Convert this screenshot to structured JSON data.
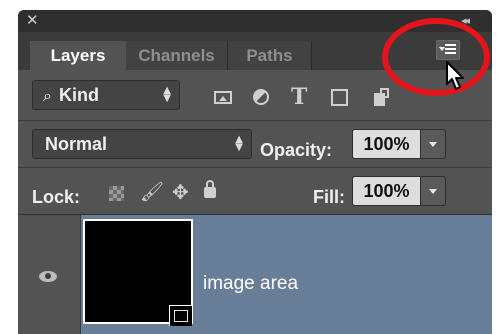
{
  "window": {
    "close_glyph": "✕",
    "collapse_glyph": "◂◂"
  },
  "tabs": [
    {
      "label": "Layers",
      "active": true
    },
    {
      "label": "Channels",
      "active": false
    },
    {
      "label": "Paths",
      "active": false
    }
  ],
  "panel_menu": {
    "icon": "panel-menu-icon",
    "highlighted": true
  },
  "filter": {
    "search_glyph": "⌕",
    "label": "Kind",
    "icons": [
      "pixel-layer-filter-icon",
      "adjustment-layer-filter-icon",
      "type-layer-filter-icon",
      "shape-layer-filter-icon",
      "smart-object-filter-icon"
    ],
    "type_glyph": "T"
  },
  "blend": {
    "mode": "Normal",
    "opacity_label": "Opacity:",
    "opacity_value": "100%"
  },
  "lock": {
    "label": "Lock:",
    "brush_glyph": "🖌",
    "move_glyph": "✥",
    "fill_label": "Fill:",
    "fill_value": "100%"
  },
  "layers": [
    {
      "name": "image area",
      "visible": true,
      "selected": true,
      "thumbnail": "black",
      "has_vector_mask": true
    }
  ],
  "colors": {
    "panel": "#535353",
    "tab_bar": "#3b3b3b",
    "selected_layer": "#687d97",
    "highlight": "#e3141b"
  }
}
